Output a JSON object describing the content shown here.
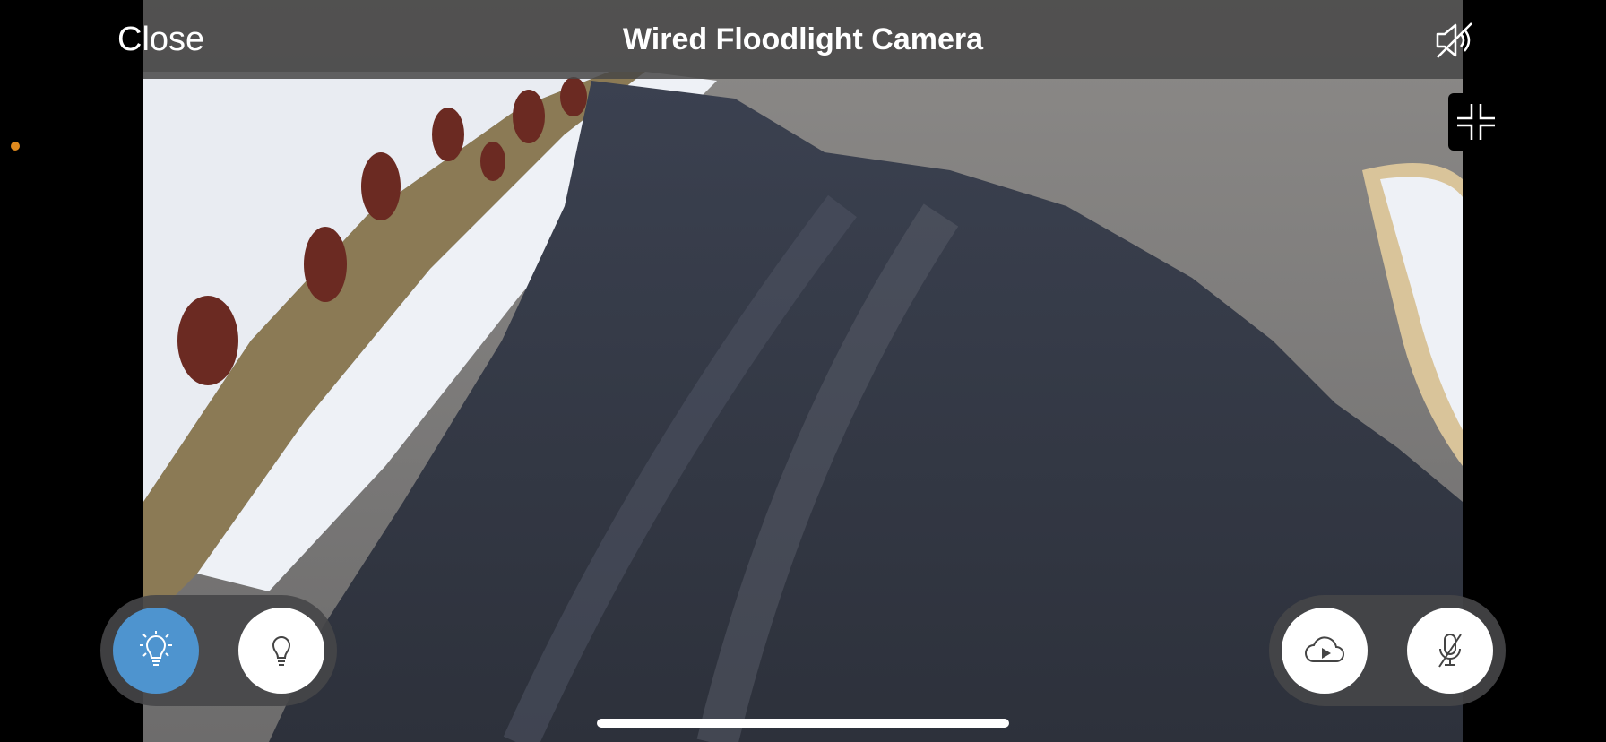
{
  "header": {
    "close_label": "Close",
    "title": "Wired Floodlight Camera"
  },
  "icons": {
    "mute": "speaker-muted-icon",
    "exit_fullscreen": "exit-fullscreen-icon",
    "floodlight_on": "floodlight-on-icon",
    "light_bulb": "light-bulb-icon",
    "cloud_play": "cloud-play-icon",
    "mic_muted": "microphone-muted-icon"
  },
  "colors": {
    "active_button": "#4e94cf",
    "status_dot": "#e08a1e"
  }
}
